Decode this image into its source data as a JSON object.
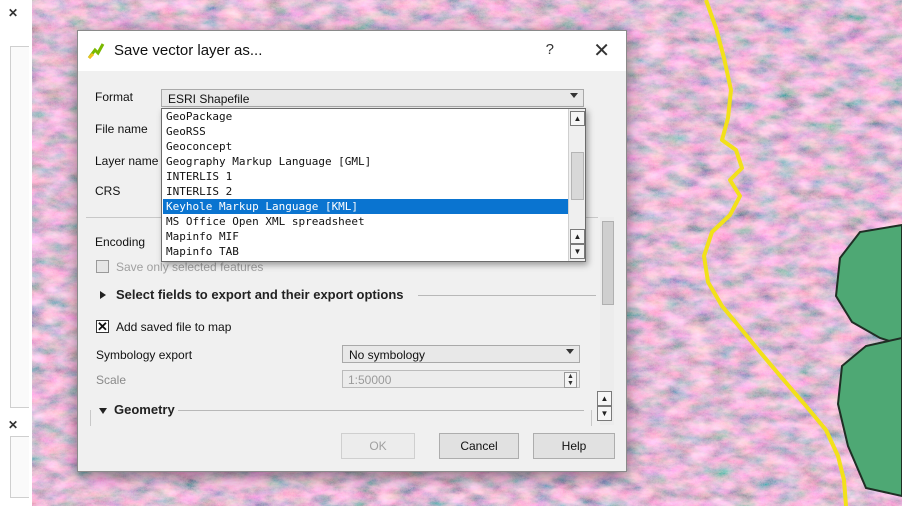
{
  "dialog": {
    "title": "Save vector layer as...",
    "help_symbol": "?",
    "close_symbol": "✕",
    "icon": "qgis-icon"
  },
  "form": {
    "format_label": "Format",
    "format_value": "ESRI Shapefile",
    "filename_label": "File name",
    "layername_label": "Layer name",
    "crs_label": "CRS",
    "encoding_label": "Encoding"
  },
  "dropdown": {
    "items": [
      "GeoPackage",
      "GeoRSS",
      "Geoconcept",
      "Geography Markup Language [GML]",
      "INTERLIS 1",
      "INTERLIS 2",
      "Keyhole Markup Language [KML]",
      "MS Office Open XML spreadsheet",
      "Mapinfo MIF",
      "Mapinfo TAB"
    ],
    "selected": "Keyhole Markup Language [KML]"
  },
  "options": {
    "save_selected_label": "Save only selected features",
    "select_fields_label": "Select fields to export and their export options",
    "add_to_map_label": "Add saved file to map",
    "symbology_label": "Symbology export",
    "symbology_value": "No symbology",
    "scale_label": "Scale",
    "scale_value": "1:50000",
    "geometry_label": "Geometry"
  },
  "buttons": {
    "ok": "OK",
    "cancel": "Cancel",
    "help": "Help"
  },
  "sidebar": {
    "close_symbol": "✕"
  },
  "colors": {
    "selection": "#0a74d0",
    "polygon_fill": "#4ea874",
    "boundary_line": "#f2e11a"
  }
}
